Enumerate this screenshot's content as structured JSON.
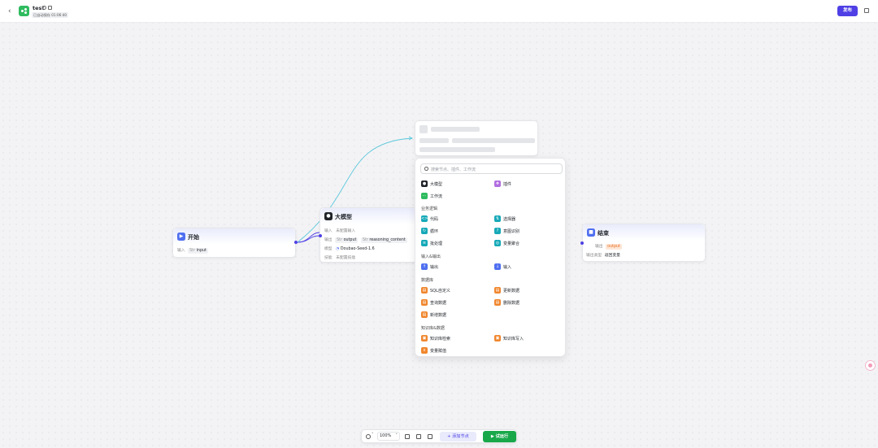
{
  "header": {
    "title": "test",
    "saved_status": "已自动保存 01:06:40",
    "publish_label": "发布"
  },
  "nodes": {
    "start": {
      "title": "开始",
      "input_label": "输入",
      "input_type": "Str",
      "input_name": "input"
    },
    "llm": {
      "title": "大模型",
      "input_label": "输入",
      "input_value": "未配置输入",
      "output_label": "输出",
      "output_type_1": "Str",
      "output_1": "output",
      "output_type_2": "Str",
      "output_2": "reasoning_content",
      "model_label": "模型",
      "model_name": "Doubao-Seed-1.6",
      "skill_label": "技能",
      "skill_value": "未配置技能"
    },
    "end": {
      "title": "结束",
      "output_label": "输出",
      "output_var": "output",
      "output_type_label": "输出类型",
      "output_type_value": "返回变量"
    }
  },
  "node_picker": {
    "search_placeholder": "搜索节点、插件、工作流",
    "top_items": [
      "大模型",
      "插件",
      "工作流"
    ],
    "sections": [
      {
        "title": "业务逻辑",
        "items": [
          "代码",
          "选择器",
          "循环",
          "意图识别",
          "批处理",
          "变量聚合"
        ]
      },
      {
        "title": "输入&输出",
        "items": [
          "输出",
          "输入"
        ]
      },
      {
        "title": "数据库",
        "items": [
          "SQL自定义",
          "更新数据",
          "查询数据",
          "删除数据",
          "新增数据"
        ]
      },
      {
        "title": "知识库&数据",
        "items": [
          "知识库检索",
          "知识库写入",
          "变量赋值"
        ]
      }
    ]
  },
  "toolbar": {
    "zoom": "100%",
    "add_node_label": "添加节点",
    "run_label": "试运行"
  },
  "colors": {
    "accent": "#4e40e5",
    "run_green": "#18a84a",
    "edge": "#5bc7dc",
    "logic_teal": "#16a9b8",
    "io_blue": "#4f6ff0",
    "db_orange": "#f0862d"
  }
}
